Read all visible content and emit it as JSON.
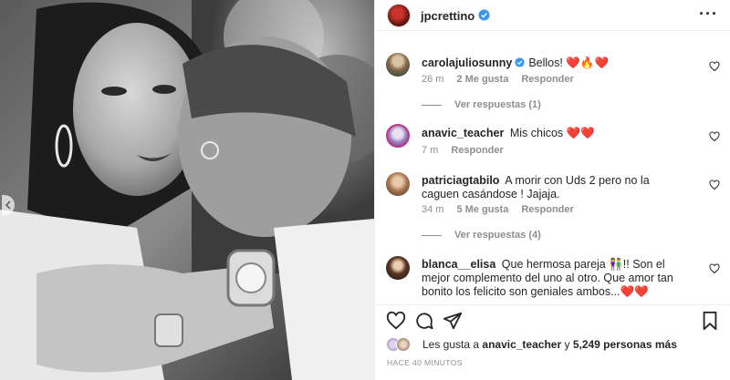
{
  "post": {
    "author": "jpcrettino",
    "more_icon": "more-horizontal-icon",
    "photo_alt": "black-and-white couple photo"
  },
  "comments": [
    {
      "user": "carolajuliosunny",
      "verified": true,
      "text": "Bellos! ❤️🔥❤️",
      "time": "26 m",
      "likes": "2 Me gusta",
      "reply": "Responder",
      "replies": "Ver respuestas (1)"
    },
    {
      "user": "anavic_teacher",
      "verified": false,
      "text": "Mis chicos ❤️❤️",
      "time": "7 m",
      "likes": "",
      "reply": "Responder",
      "replies": ""
    },
    {
      "user": "patriciagtabilo",
      "verified": false,
      "text": "A morir con Uds 2 pero no la caguen casándose ! Jajaja.",
      "time": "34 m",
      "likes": "5 Me gusta",
      "reply": "Responder",
      "replies": "Ver respuestas (4)"
    },
    {
      "user": "blanca__elisa",
      "verified": false,
      "text": "Que hermosa pareja 👫!! Son el mejor complemento del uno al otro. Que amor tan bonito los felicito son geniales ambos...❤️❤️",
      "time": "",
      "likes": "",
      "reply": "",
      "replies": ""
    }
  ],
  "likes": {
    "prefix": "Les gusta a",
    "user": "anavic_teacher",
    "joiner": "y",
    "count": "5,249 personas más"
  },
  "timestamp": "HACE 40 MINUTOS",
  "colors": {
    "verified": "#3897f0",
    "meta": "#8e8e8e",
    "border": "#efefef"
  }
}
